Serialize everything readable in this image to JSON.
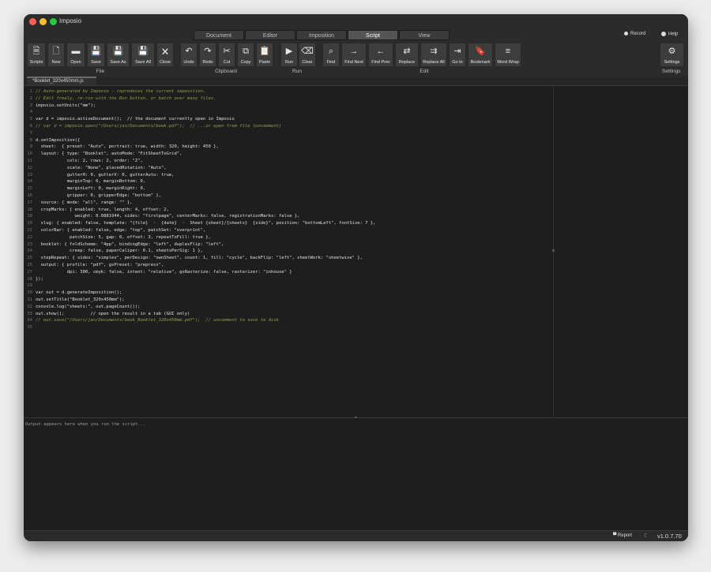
{
  "window": {
    "title": "Imposio"
  },
  "mode_tabs": [
    {
      "label": "Document",
      "active": false
    },
    {
      "label": "Editor",
      "active": false
    },
    {
      "label": "Imposition",
      "active": false
    },
    {
      "label": "Script",
      "active": true
    },
    {
      "label": "View",
      "active": false
    }
  ],
  "header_right": {
    "record": "Record",
    "help": "Help"
  },
  "toolbar": {
    "groups": {
      "file": "File",
      "clipboard": "Clipboard",
      "run": "Run",
      "edit": "Edit",
      "settings": "Settings"
    },
    "buttons": [
      {
        "label": "Scripts",
        "icon": "document-icon",
        "glyph": "🗎"
      },
      {
        "label": "New",
        "icon": "new-file-icon",
        "glyph": "🗋"
      },
      {
        "label": "Open",
        "icon": "folder-icon",
        "glyph": "▬"
      },
      {
        "label": "Save",
        "icon": "save-icon",
        "glyph": "💾"
      },
      {
        "label": "Save As",
        "icon": "save-as-icon",
        "glyph": "💾"
      },
      {
        "label": "Save All",
        "icon": "save-all-icon",
        "glyph": "💾"
      },
      {
        "label": "Close",
        "icon": "close-file-icon",
        "glyph": "🗙"
      },
      {
        "label": "Undo",
        "icon": "undo-icon",
        "glyph": "↶"
      },
      {
        "label": "Redo",
        "icon": "redo-icon",
        "glyph": "↷"
      },
      {
        "label": "Cut",
        "icon": "cut-icon",
        "glyph": "✂"
      },
      {
        "label": "Copy",
        "icon": "copy-icon",
        "glyph": "⧉"
      },
      {
        "label": "Paste",
        "icon": "paste-icon",
        "glyph": "📋"
      },
      {
        "label": "Run",
        "icon": "run-icon",
        "glyph": "▶"
      },
      {
        "label": "Clear",
        "icon": "clear-icon",
        "glyph": "⌫"
      },
      {
        "label": "Find",
        "icon": "find-icon",
        "glyph": "⌕"
      },
      {
        "label": "Find Next",
        "icon": "find-next-icon",
        "glyph": "→"
      },
      {
        "label": "Find Prev",
        "icon": "find-prev-icon",
        "glyph": "←"
      },
      {
        "label": "Replace",
        "icon": "replace-icon",
        "glyph": "⇄"
      },
      {
        "label": "Replace All",
        "icon": "replace-all-icon",
        "glyph": "⇉"
      },
      {
        "label": "Go to",
        "icon": "goto-icon",
        "glyph": "⇥"
      },
      {
        "label": "Bookmark",
        "icon": "bookmark-icon",
        "glyph": "🔖"
      },
      {
        "label": "Word Wrap",
        "icon": "word-wrap-icon",
        "glyph": "≡"
      },
      {
        "label": "Settings",
        "icon": "gear-icon",
        "glyph": "⚙"
      }
    ]
  },
  "file_tab": {
    "label": "*Booklet_320x450mm.js"
  },
  "code_lines": [
    "// Auto-generated by Imposio — reproduces the current imposition.",
    "// Edit freely, re-run with the Run button, or batch over many files.",
    "imposio.setUnits(\"mm\");",
    "",
    "var d = imposio.activeDocument();  // the document currently open in Imposio",
    "// var d = imposio.open(\"/Users/jan/Documents/book.pdf\");  // ...or open from file (uncomment)",
    "",
    "d.setImposition({",
    "  sheet:  { preset: \"Auto\", portrait: true, width: 320, height: 450 },",
    "  layout: { type: \"Booklet\", autoMode: \"FitSheetToGrid\",",
    "            cols: 2, rows: 2, order: \"Z\",",
    "            scale: \"None\", placedRotation: \"Auto\",",
    "            gutterH: 0, gutterV: 0, gutterAuto: true,",
    "            marginTop: 0, marginBottom: 0,",
    "            marginLeft: 0, marginRight: 0,",
    "            gripper: 0, gripperEdge: \"bottom\" },",
    "  source: { mode: \"all\", range: \"\" },",
    "  cropMarks: { enabled: true, length: 4, offset: 2,",
    "               weight: 0.0881944, sides: \"firstpage\", centerMarks: false, registrationMarks: false },",
    "  slug: { enabled: false, template: \"{file}  ·  {date}  ·  Sheet {sheet}/{sheets}  {side}\", position: \"bottomLeft\", fontSize: 7 },",
    "  colorBar: { enabled: false, edge: \"top\", patchSet: \"overprint\",",
    "             patchSize: 5, gap: 0, offset: 3, repeatToFill: true },",
    "  booklet: { foldScheme: \"4pp\", bindingEdge: \"left\", duplexFlip: \"left\",",
    "             creep: false, paperCaliper: 0.1, sheetsPerSig: 1 },",
    "  stepRepeat: { sides: \"simplex\", perDesign: \"ownSheet\", count: 1, fill: \"cycle\", backFlip: \"left\", sheetWork: \"sheetwise\" },",
    "  output: { profile: \"pdf\", gsPreset: \"prepress\",",
    "            dpi: 300, cmyk: false, intent: \"relative\", gsRasterize: false, rasterizer: \"inhouse\" }",
    "});",
    "",
    "var out = d.generateImposition();",
    "out.setTitle(\"Booklet_320x450mm\");",
    "console.log(\"sheets:\", out.pageCount());",
    "out.show();          // open the result in a tab (GUI only)",
    "// out.save(\"/Users/jan/Documents/book_Booklet_320x450mm.pdf\");  // uncomment to save to disk",
    ""
  ],
  "output": {
    "placeholder": "Output appears here when you run the script..."
  },
  "status": {
    "report": "Report",
    "version": "v1.0.7.70"
  }
}
